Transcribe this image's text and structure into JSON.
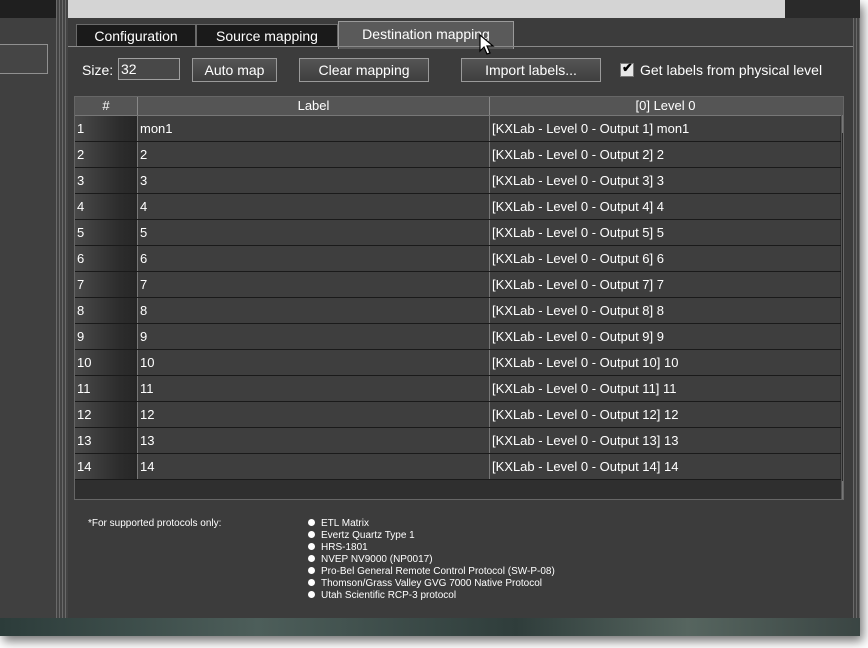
{
  "tabs": [
    {
      "label": "Configuration",
      "active": false
    },
    {
      "label": "Source mapping",
      "active": false
    },
    {
      "label": "Destination mapping",
      "active": true
    }
  ],
  "toolbar": {
    "size_label": "Size:",
    "size_value": "32",
    "auto_map": "Auto map",
    "clear_mapping": "Clear mapping",
    "import_labels": "Import labels...",
    "checkbox_checked": true,
    "checkbox_label": "Get labels from physical level"
  },
  "table": {
    "columns": [
      "#",
      "Label",
      "[0] Level 0"
    ],
    "rows": [
      {
        "num": "1",
        "label": "mon1",
        "level": "[KXLab - Level 0 - Output 1] mon1"
      },
      {
        "num": "2",
        "label": "2",
        "level": "[KXLab - Level 0 - Output 2] 2"
      },
      {
        "num": "3",
        "label": "3",
        "level": "[KXLab - Level 0 - Output 3] 3"
      },
      {
        "num": "4",
        "label": "4",
        "level": "[KXLab - Level 0 - Output 4] 4"
      },
      {
        "num": "5",
        "label": "5",
        "level": "[KXLab - Level 0 - Output 5] 5"
      },
      {
        "num": "6",
        "label": "6",
        "level": "[KXLab - Level 0 - Output 6] 6"
      },
      {
        "num": "7",
        "label": "7",
        "level": "[KXLab - Level 0 - Output 7] 7"
      },
      {
        "num": "8",
        "label": "8",
        "level": "[KXLab - Level 0 - Output 8] 8"
      },
      {
        "num": "9",
        "label": "9",
        "level": "[KXLab - Level 0 - Output 9] 9"
      },
      {
        "num": "10",
        "label": "10",
        "level": "[KXLab - Level 0 - Output 10] 10"
      },
      {
        "num": "11",
        "label": "11",
        "level": "[KXLab - Level 0 - Output 11] 11"
      },
      {
        "num": "12",
        "label": "12",
        "level": "[KXLab - Level 0 - Output 12] 12"
      },
      {
        "num": "13",
        "label": "13",
        "level": "[KXLab - Level 0 - Output 13] 13"
      },
      {
        "num": "14",
        "label": "14",
        "level": "[KXLab - Level 0 - Output 14] 14"
      }
    ]
  },
  "notes": {
    "lead": "*For supported protocols only:",
    "items": [
      "ETL Matrix",
      "Evertz Quartz Type 1",
      "HRS-1801",
      "NVEP NV9000 (NP0017)",
      "Pro-Bel General Remote Control Protocol (SW-P-08)",
      "Thomson/Grass Valley GVG 7000 Native Protocol",
      "Utah Scientific RCP-3 protocol"
    ]
  },
  "icons": {
    "scroll_up": "scroll-up-arrow",
    "scroll_down": "scroll-down-arrow",
    "cursor": "mouse-pointer-icon",
    "bullet": "bullet-dot-icon"
  }
}
